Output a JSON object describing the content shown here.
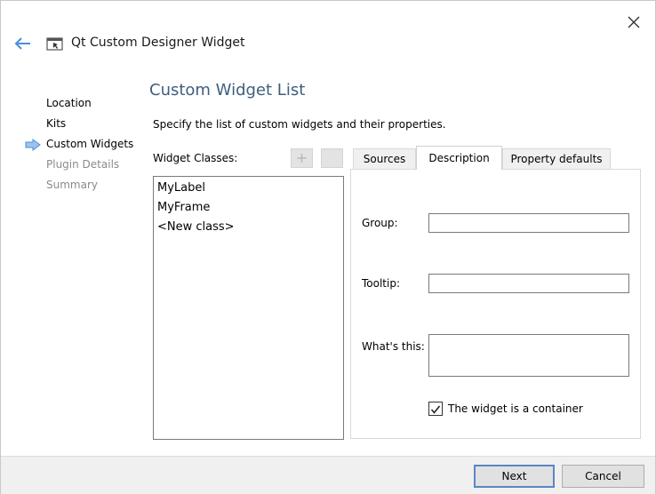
{
  "window": {
    "title": "Qt Custom Designer Widget",
    "back_icon": "back-arrow-icon",
    "app_icon": "qt-creator-icon",
    "close_icon": "close-icon"
  },
  "steps": [
    {
      "label": "Location",
      "state": "done"
    },
    {
      "label": "Kits",
      "state": "done"
    },
    {
      "label": "Custom Widgets",
      "state": "current"
    },
    {
      "label": "Plugin Details",
      "state": "pending"
    },
    {
      "label": "Summary",
      "state": "pending"
    }
  ],
  "page": {
    "heading": "Custom Widget List",
    "description": "Specify the list of custom widgets and their properties."
  },
  "classes": {
    "label": "Widget Classes:",
    "items": [
      "MyLabel",
      "MyFrame",
      "<New class>"
    ]
  },
  "tabs": [
    {
      "label": "Sources",
      "active": false
    },
    {
      "label": "Description",
      "active": true
    },
    {
      "label": "Property defaults",
      "active": false
    }
  ],
  "description_tab": {
    "group_label": "Group:",
    "group_value": "",
    "tooltip_label": "Tooltip:",
    "tooltip_value": "",
    "whatsthis_label": "What's this:",
    "whatsthis_value": "",
    "container_label": "The widget is a container",
    "container_checked": true
  },
  "buttons": {
    "next": "Next",
    "cancel": "Cancel"
  },
  "colors": {
    "heading": "#3f5e7f",
    "accent": "#4a90d9",
    "inactive_step": "#8a8a8a"
  }
}
